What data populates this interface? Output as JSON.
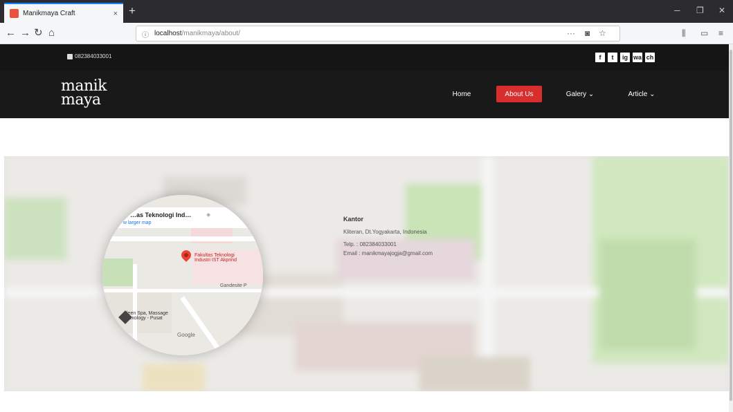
{
  "browser": {
    "tab_title": "Manikmaya Craft",
    "tab_close": "×",
    "new_tab": "+",
    "url_host": "localhost",
    "url_path": "/manikmaya/about/",
    "page_actions": "···",
    "pocket_icon": "pocket-icon",
    "bookmark_icon": "star-icon"
  },
  "site": {
    "phone": "082384033001",
    "socials": [
      "f",
      "t",
      "ig",
      "wa",
      "ch"
    ],
    "logo_line1": "manik",
    "logo_line2": "maya",
    "nav": [
      "Home",
      "About Us",
      "Galery ⌄",
      "Article ⌄"
    ]
  },
  "map": {
    "place_title": "…as Teknologi Ind…",
    "link": "w larger map",
    "marker_label": "Fakultas Teknologi\nIndustri IST Akprind",
    "label_right": "Gandesite P",
    "label_bottom": "…leen Spa, Massage\n…flexology - Pusat",
    "google": "Google"
  },
  "office": {
    "title": "Kantor",
    "address": "Kliteran, Dt.Yogyakarta, Indonesia",
    "phone": "Telp. : 082384033001",
    "email": "Email : manikmayajogja@gmail.com"
  },
  "colors": {
    "topbar": "#151515",
    "navbar": "#191919",
    "active": "#d92e2e"
  }
}
